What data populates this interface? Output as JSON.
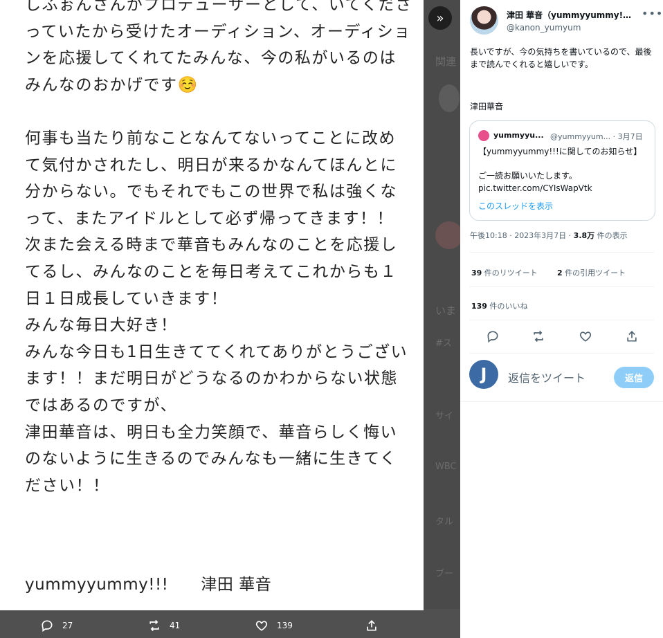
{
  "image": {
    "text": "しふぉんさんがプロデューサーとして、いてくださっていたから受けたオーディション、オーディションを応援してくれてたみんな、今の私がいるのはみんなのおかげです☺️\n\n何事も当たり前なことなんてないってことに改めて気付かされたし、明日が来るかなんてほんとに分からない。でもそれでもこの世界で私は強くなって、またアイドルとして必ず帰ってきます！！\n次また会える時まで華音もみんなのことを応援してるし、みんなのことを毎日考えてこれからも１日１日成長していきます！\nみんな毎日大好き！\nみんな今日も1日生きててくれてありがとうございます！！まだ明日がどうなるのかわからない状態ではあるのですが、\n津田華音は、明日も全力笑顔で、華音らしく悔いのないように生きるのでみんなも一緒に生きてください！！",
    "signature": "yummyyummy!!!　　津田 華音"
  },
  "bottom_bar": {
    "reply_count": "27",
    "retweet_count": "41",
    "like_count": "139"
  },
  "tweet": {
    "display_name": "津田 華音（yummyyummy!…",
    "handle": "@kanon_yumyum",
    "text": "長いですが、今の気持ちを書いているので、最後まで読んでくれると嬉しいです。",
    "signature": "津田華音",
    "quote": {
      "name": "yummyyu...",
      "handle_date": "@yummyyum... · 3月7日",
      "body": "【yummyyummy!!!に関してのお知らせ】\n\nご一読お願いいたします。\npic.twitter.com/CYIsWapVtk",
      "thread_link": "このスレッドを表示"
    },
    "meta_time": "午後10:18 · 2023年3月7日 · ",
    "meta_views": "3.8万",
    "meta_views_label": " 件の表示",
    "retweets": "39",
    "retweets_label": " 件のリツイート",
    "quotes": "2",
    "quotes_label": " 件の引用ツイート",
    "likes": "139",
    "likes_label": " 件のいいね"
  },
  "reply": {
    "avatar_letter": "J",
    "placeholder": "返信をツイート",
    "button": "返信"
  },
  "background": {
    "ghost_texts": [
      "関連",
      "いま",
      "#ス",
      "サイ",
      "WBC",
      "タル",
      "ブー"
    ]
  }
}
